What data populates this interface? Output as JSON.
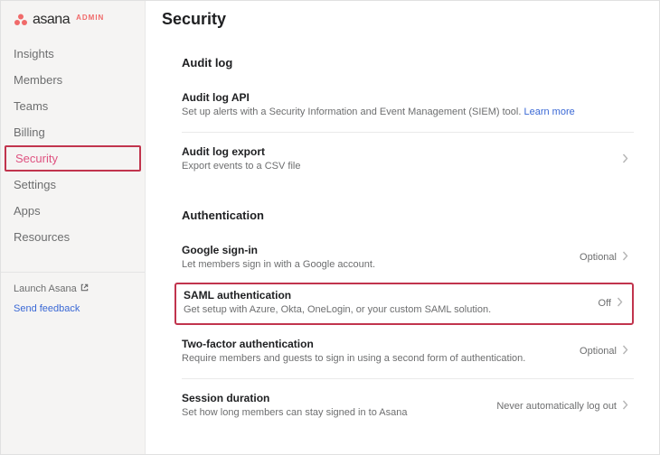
{
  "brand": {
    "name": "asana",
    "admin": "ADMIN"
  },
  "sidebar": {
    "items": [
      {
        "label": "Insights"
      },
      {
        "label": "Members"
      },
      {
        "label": "Teams"
      },
      {
        "label": "Billing"
      },
      {
        "label": "Security"
      },
      {
        "label": "Settings"
      },
      {
        "label": "Apps"
      },
      {
        "label": "Resources"
      }
    ],
    "launch": "Launch Asana",
    "feedback": "Send feedback"
  },
  "page": {
    "title": "Security"
  },
  "sections": {
    "audit": {
      "header": "Audit log",
      "api": {
        "title": "Audit log API",
        "desc": "Set up alerts with a Security Information and Event Management (SIEM) tool. ",
        "link": "Learn more"
      },
      "export": {
        "title": "Audit log export",
        "desc": "Export events to a CSV file"
      }
    },
    "auth": {
      "header": "Authentication",
      "google": {
        "title": "Google sign-in",
        "desc": "Let members sign in with a Google account.",
        "status": "Optional"
      },
      "saml": {
        "title": "SAML authentication",
        "desc": "Get setup with Azure, Okta, OneLogin, or your custom SAML solution.",
        "status": "Off"
      },
      "twofa": {
        "title": "Two-factor authentication",
        "desc": "Require members and guests to sign in using a second form of authentication.",
        "status": "Optional"
      },
      "session": {
        "title": "Session duration",
        "desc": "Set how long members can stay signed in to Asana",
        "status": "Never automatically log out"
      }
    }
  }
}
